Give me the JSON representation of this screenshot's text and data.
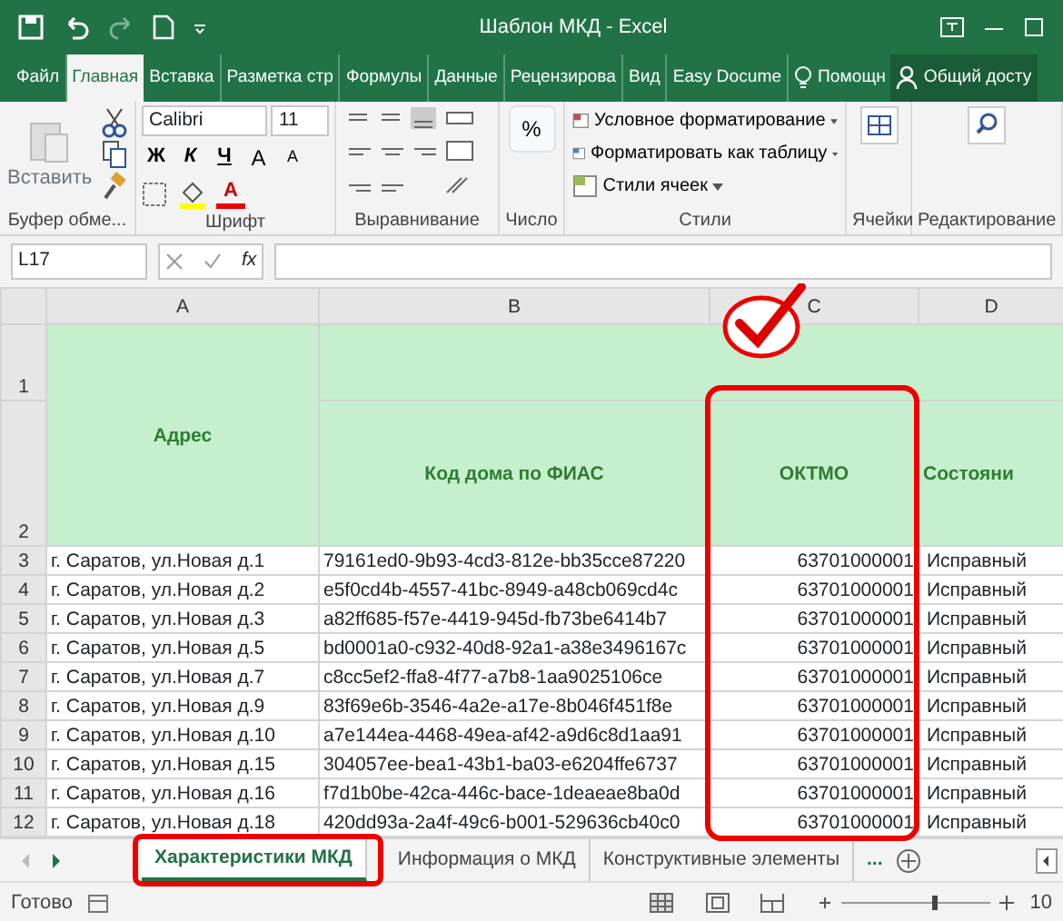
{
  "window": {
    "title": "Шаблон МКД - Excel"
  },
  "ribbon_tabs": [
    {
      "label": "Файл",
      "selected": false
    },
    {
      "label": "Главная",
      "selected": true
    },
    {
      "label": "Вставка",
      "selected": false
    },
    {
      "label": "Разметка стр",
      "selected": false
    },
    {
      "label": "Формулы",
      "selected": false
    },
    {
      "label": "Данные",
      "selected": false
    },
    {
      "label": "Рецензирова",
      "selected": false
    },
    {
      "label": "Вид",
      "selected": false
    },
    {
      "label": "Easy Docume",
      "selected": false
    }
  ],
  "tell_me": "Помощн",
  "share": "Общий досту",
  "ribbon": {
    "clipboard": {
      "paste": "Вставить",
      "label": "Буфер обме..."
    },
    "font": {
      "name": "Calibri",
      "size": "11",
      "styles": [
        "Ж",
        "К",
        "Ч"
      ],
      "grow": "A",
      "shrink": "A",
      "color_letter": "A",
      "label": "Шрифт"
    },
    "alignment": {
      "label": "Выравнивание"
    },
    "number": {
      "symbol": "%",
      "label": "Число"
    },
    "styles": {
      "items": [
        "Условное форматирование",
        "Форматировать как таблицу",
        "Стили ячеек"
      ],
      "label": "Стили"
    },
    "cells": {
      "label": "Ячейки"
    },
    "editing": {
      "label": "Редактирование"
    }
  },
  "formula_bar": {
    "name_box": "L17",
    "fx": "fx"
  },
  "sheet": {
    "columns": [
      "A",
      "B",
      "C",
      "D"
    ],
    "header": {
      "address": "Адрес",
      "row_numbers": [
        "1",
        "2"
      ],
      "columns": [
        "Код дома по ФИАС",
        "ОКТМО",
        "Состояни"
      ]
    },
    "rows": [
      {
        "number": "3",
        "cells": [
          "г. Саратов, ул.Новая д.1",
          "79161ed0-9b93-4cd3-812e-bb35cce87220",
          "63701000001",
          "Исправный"
        ]
      },
      {
        "number": "4",
        "cells": [
          "г. Саратов, ул.Новая д.2",
          "e5f0cd4b-4557-41bc-8949-a48cb069cd4c",
          "63701000001",
          "Исправный"
        ]
      },
      {
        "number": "5",
        "cells": [
          "г. Саратов, ул.Новая д.3",
          "a82ff685-f57e-4419-945d-fb73be6414b7",
          "63701000001",
          "Исправный"
        ]
      },
      {
        "number": "6",
        "cells": [
          "г. Саратов, ул.Новая д.5",
          "bd0001a0-c932-40d8-92a1-a38e3496167c",
          "63701000001",
          "Исправный"
        ]
      },
      {
        "number": "7",
        "cells": [
          "г. Саратов, ул.Новая д.7",
          "c8cc5ef2-ffa8-4f77-a7b8-1aa9025106ce",
          "63701000001",
          "Исправный"
        ]
      },
      {
        "number": "8",
        "cells": [
          "г. Саратов, ул.Новая д.9",
          "83f69e6b-3546-4a2e-a17e-8b046f451f8e",
          "63701000001",
          "Исправный"
        ]
      },
      {
        "number": "9",
        "cells": [
          "г. Саратов, ул.Новая д.10",
          "a7e144ea-4468-49ea-af42-a9d6c8d1aa91",
          "63701000001",
          "Исправный"
        ]
      },
      {
        "number": "10",
        "cells": [
          "г. Саратов, ул.Новая д.15",
          "304057ee-bea1-43b1-ba03-e6204ffe6737",
          "63701000001",
          "Исправный"
        ]
      },
      {
        "number": "11",
        "cells": [
          "г. Саратов, ул.Новая д.16",
          "f7d1b0be-42ca-446c-bace-1deaeae8ba0d",
          "63701000001",
          "Исправный"
        ]
      },
      {
        "number": "12",
        "cells": [
          "г. Саратов, ул.Новая д.18",
          "420dd93a-2a4f-49c6-b001-529636cb40c0",
          "63701000001",
          "Исправный"
        ]
      }
    ]
  },
  "sheet_tabs": [
    {
      "label": "Характеристики МКД",
      "selected": true
    },
    {
      "label": "Информация о МКД",
      "selected": false
    },
    {
      "label": "Конструктивные элементы",
      "selected": false
    }
  ],
  "more_tabs": "...",
  "status_bar": {
    "status": "Готово",
    "zoom": "10"
  },
  "annotations": [
    {
      "kind": "checkmark"
    },
    {
      "kind": "column_frame"
    },
    {
      "kind": "tab_frame"
    }
  ]
}
